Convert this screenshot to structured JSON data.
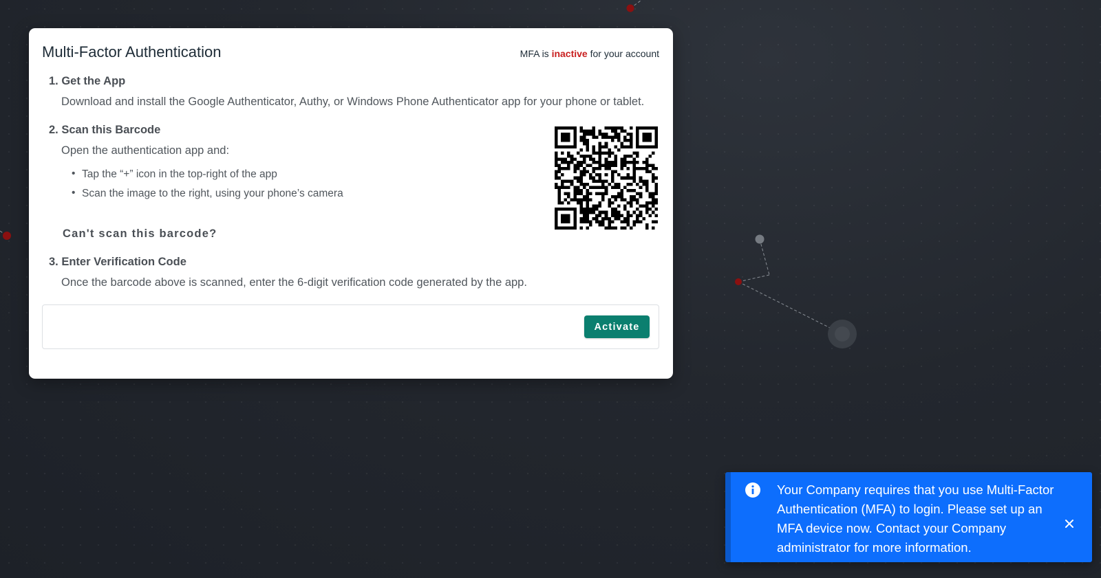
{
  "modal": {
    "title": "Multi-Factor Authentication",
    "status_prefix": "MFA is",
    "status_value": "inactive",
    "status_suffix": "for your account"
  },
  "steps": {
    "get_app": {
      "title": "1. Get the App",
      "description": "Download and install the Google Authenticator, Authy, or Windows Phone Authenticator app for your phone or tablet."
    },
    "scan": {
      "title": "2. Scan this Barcode",
      "description": "Open the authentication app and:",
      "bullets": [
        "Tap the “+” icon in the top-right of the app",
        "Scan the image to the right, using your phone’s camera"
      ],
      "cant_scan_link": "Can't scan this barcode?",
      "qr_icon": "qr-code"
    },
    "verify": {
      "title": "3. Enter Verification Code",
      "description": "Once the barcode above is scanned, enter the 6-digit verification code generated by the app."
    }
  },
  "code_input": {
    "value": "",
    "placeholder": ""
  },
  "activate_label": "Activate",
  "toast": {
    "icon": "info-icon",
    "message": "Your Company requires that you use Multi-Factor Authentication (MFA) to login. Please set up an MFA device now. Contact your Company administrator for more information.",
    "close_icon": "close-icon"
  },
  "colors": {
    "accent_button": "#0b7f6f",
    "toast_background": "#0d6efd",
    "status_inactive": "#c81e1e"
  }
}
